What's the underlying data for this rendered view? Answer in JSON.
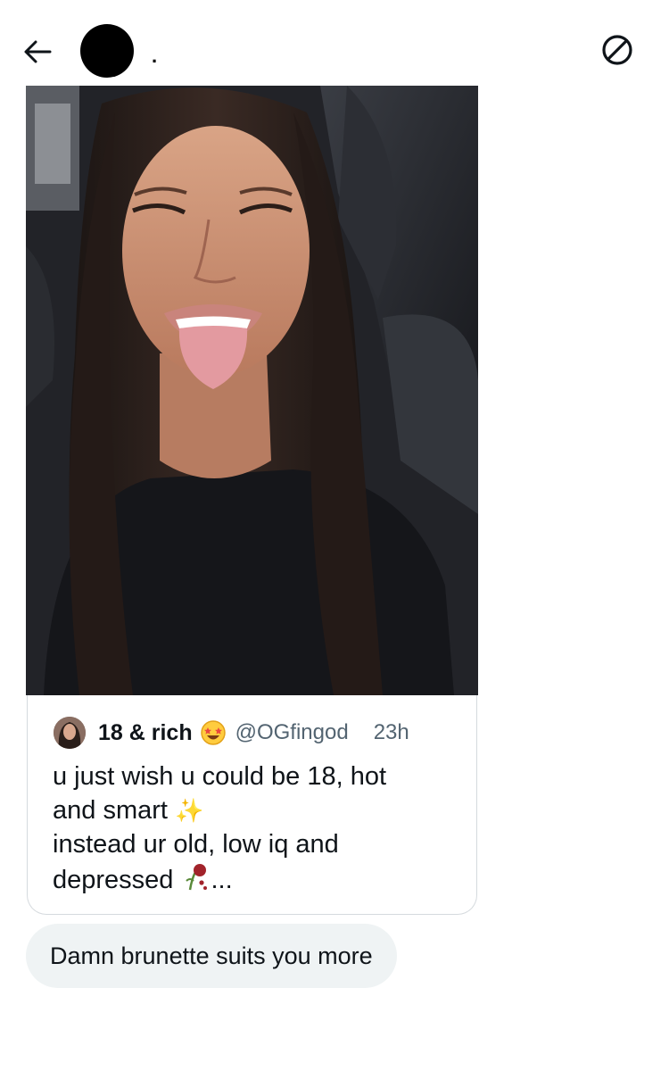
{
  "header": {
    "back_icon": "arrow-left-icon",
    "contact_name": ".",
    "block_icon": "block-icon"
  },
  "shared_media": {
    "kind": "photo",
    "description_icon": "photo"
  },
  "quote": {
    "display_name": "18 & rich",
    "emoji_icon": "star-struck-emoji",
    "handle": "@OGfingod",
    "time": "23h",
    "lines": [
      "u just wish u could be 18, hot",
      "and smart",
      "instead ur old, low iq and",
      "depressed"
    ],
    "line2_emoji": "✨",
    "line4_suffix": "..."
  },
  "message": {
    "text": "Damn brunette suits you more"
  },
  "colors": {
    "text_primary": "#0f1419",
    "text_secondary": "#536471",
    "bubble_bg": "#eff3f4",
    "card_border": "#d5dade"
  }
}
